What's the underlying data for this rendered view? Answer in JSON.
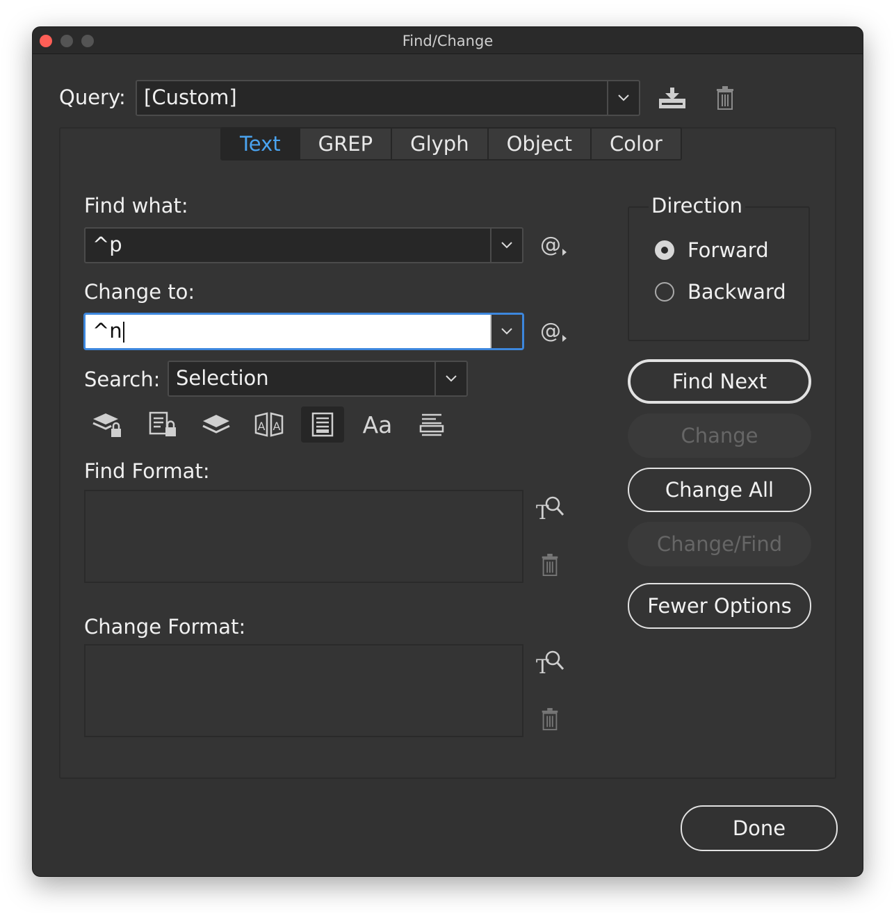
{
  "window": {
    "title": "Find/Change"
  },
  "query": {
    "label": "Query:",
    "value": "[Custom]",
    "save_icon": "save-query-icon",
    "delete_icon": "trash-icon"
  },
  "tabs": [
    {
      "label": "Text",
      "selected": true
    },
    {
      "label": "GREP",
      "selected": false
    },
    {
      "label": "Glyph",
      "selected": false
    },
    {
      "label": "Object",
      "selected": false
    },
    {
      "label": "Color",
      "selected": false
    }
  ],
  "find": {
    "label": "Find what:",
    "value": "^p",
    "special_char": "@"
  },
  "change": {
    "label": "Change to:",
    "value": "^n",
    "special_char": "@"
  },
  "search": {
    "label": "Search:",
    "value": "Selection"
  },
  "options": {
    "icons": [
      "locked-layers-icon",
      "locked-stories-icon",
      "hidden-layers-icon",
      "master-pages-icon",
      "footnotes-icon",
      "case-sensitive-icon",
      "whole-word-icon"
    ],
    "case_label": "Aa",
    "selected_index": 4
  },
  "find_format": {
    "label": "Find Format:"
  },
  "change_format": {
    "label": "Change Format:"
  },
  "direction": {
    "title": "Direction",
    "options": [
      {
        "label": "Forward",
        "checked": true
      },
      {
        "label": "Backward",
        "checked": false
      }
    ]
  },
  "buttons": {
    "find_next": "Find Next",
    "change": "Change",
    "change_all": "Change All",
    "change_find": "Change/Find",
    "fewer_options": "Fewer Options",
    "done": "Done"
  },
  "colors": {
    "accent": "#3d87dd",
    "tab_selected_text": "#4aa3f0",
    "close": "#fe5f57"
  }
}
